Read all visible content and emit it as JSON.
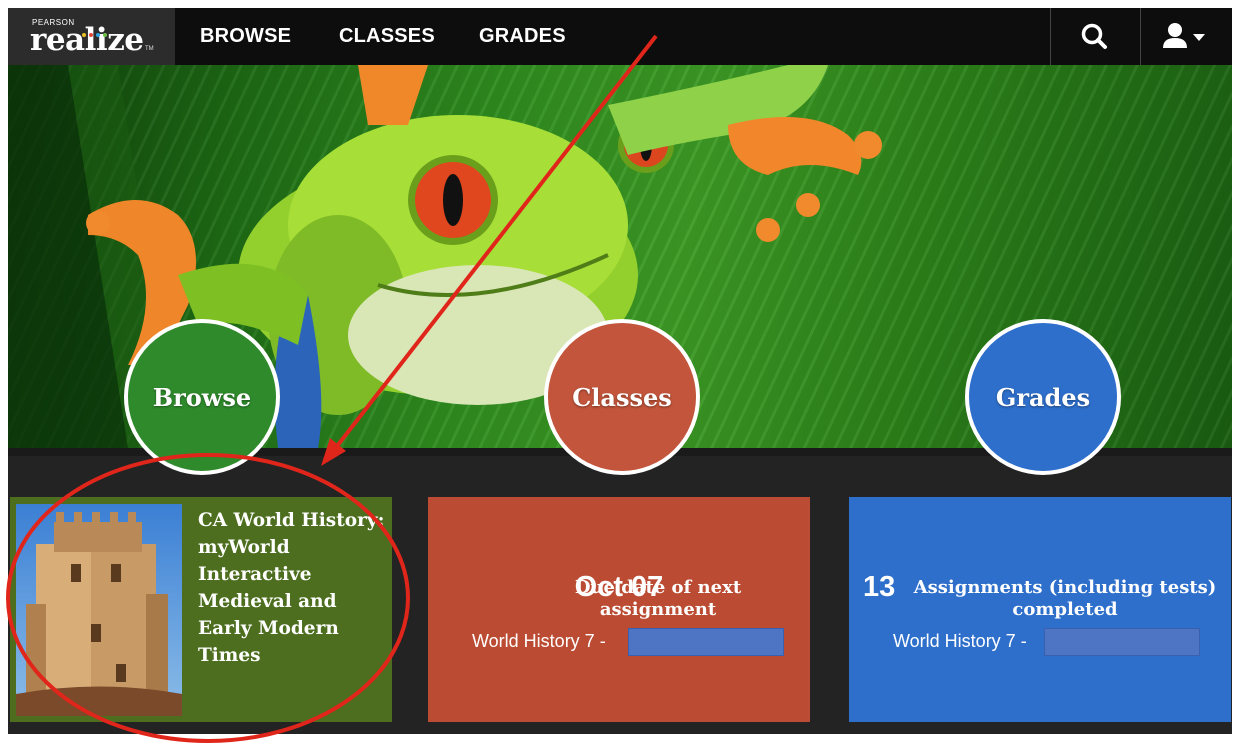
{
  "brand": {
    "company": "PEARSON",
    "product": "realize",
    "trademark": "TM",
    "dot_colors": [
      "#e8c024",
      "#e2473a",
      "#2aa3e0",
      "#6cc04a"
    ]
  },
  "nav": {
    "links": [
      {
        "label": "BROWSE"
      },
      {
        "label": "CLASSES"
      },
      {
        "label": "GRADES"
      }
    ],
    "search_icon": "search-icon",
    "user_icon": "user-icon"
  },
  "hero": {
    "image": "red-eyed-tree-frog-on-leaf",
    "circles": [
      {
        "label": "Browse",
        "color": "#2f8a2c"
      },
      {
        "label": "Classes",
        "color": "#c2553b"
      },
      {
        "label": "Grades",
        "color": "#2e6fcb"
      }
    ]
  },
  "tiles": {
    "browse": {
      "title": "CA World History: myWorld Interactive Medieval and Early Modern Times",
      "cover": "castle-tower-image",
      "color": "#4c6e1e"
    },
    "classes": {
      "big": "Oct 07",
      "desc": "Due date of next assignment",
      "class_prefix": "World History 7 -",
      "color": "#bb4c33"
    },
    "grades": {
      "big": "13",
      "desc": "Assignments (including tests) completed",
      "class_prefix": "World History 7 -",
      "color": "#2e6fcb"
    }
  },
  "annotation": {
    "color": "#e0261b"
  }
}
